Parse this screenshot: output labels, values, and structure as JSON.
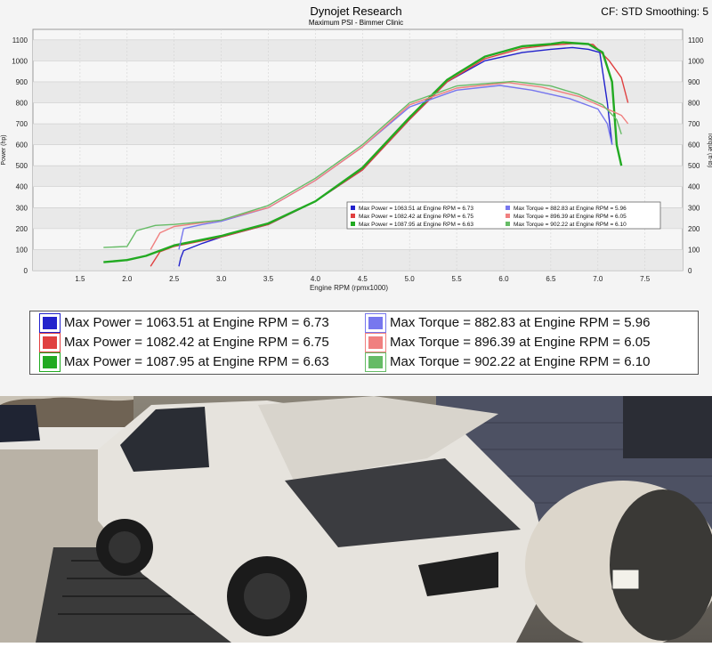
{
  "header": {
    "title": "Dynojet Research",
    "subtitle": "Maximum PSI - Bimmer Clinic",
    "right_info": "CF: STD Smoothing: 5"
  },
  "chart_data": {
    "type": "line",
    "xlabel": "Engine RPM (rpmx1000)",
    "ylabel_left": "Power (hp)",
    "ylabel_right": "Torque (ft-lb)",
    "xlim": [
      1.0,
      7.9
    ],
    "ylim": [
      0,
      1150
    ],
    "xticks": [
      "1.5",
      "2.0",
      "2.5",
      "3.0",
      "3.5",
      "4.0",
      "4.5",
      "5.0",
      "5.5",
      "6.0",
      "6.5",
      "7.0",
      "7.5"
    ],
    "yticks": [
      "0",
      "100",
      "200",
      "300",
      "400",
      "500",
      "600",
      "700",
      "800",
      "900",
      "1000",
      "1100"
    ],
    "grid": true,
    "series": [
      {
        "name": "Max Power = 1063.51 at Engine RPM = 6.73",
        "kind": "power",
        "color": "#2222cc",
        "x": [
          2.55,
          2.57,
          2.6,
          2.8,
          3.0,
          3.5,
          4.0,
          4.5,
          5.0,
          5.4,
          5.8,
          6.2,
          6.5,
          6.73,
          6.9,
          7.02,
          7.1,
          7.15
        ],
        "y": [
          20,
          60,
          95,
          130,
          160,
          220,
          330,
          480,
          720,
          900,
          1000,
          1040,
          1055,
          1063.51,
          1055,
          1040,
          800,
          600
        ]
      },
      {
        "name": "Max Power = 1082.42 at Engine RPM = 6.75",
        "kind": "power",
        "color": "#e04040",
        "x": [
          2.25,
          2.3,
          2.35,
          2.5,
          3.0,
          3.5,
          4.0,
          4.5,
          5.0,
          5.4,
          5.8,
          6.2,
          6.5,
          6.75,
          6.95,
          7.12,
          7.25,
          7.32
        ],
        "y": [
          20,
          55,
          90,
          115,
          160,
          220,
          330,
          480,
          720,
          900,
          1010,
          1060,
          1075,
          1082.42,
          1078,
          1000,
          920,
          800
        ]
      },
      {
        "name": "Max Power = 1087.95 at Engine RPM = 6.63",
        "kind": "power",
        "color": "#22aa22",
        "x": [
          1.75,
          2.0,
          2.2,
          2.5,
          3.0,
          3.5,
          4.0,
          4.5,
          5.0,
          5.4,
          5.8,
          6.2,
          6.5,
          6.63,
          6.9,
          7.05,
          7.15,
          7.2,
          7.25
        ],
        "y": [
          40,
          50,
          70,
          120,
          165,
          225,
          330,
          490,
          730,
          910,
          1020,
          1070,
          1080,
          1087.95,
          1080,
          1040,
          900,
          600,
          500
        ]
      },
      {
        "name": "Max Torque = 882.83 at Engine RPM = 5.96",
        "kind": "torque",
        "color": "#7777ee",
        "x": [
          2.55,
          2.6,
          2.8,
          3.0,
          3.5,
          4.0,
          4.5,
          5.0,
          5.5,
          5.96,
          6.3,
          6.7,
          7.0,
          7.1,
          7.15
        ],
        "y": [
          100,
          200,
          220,
          235,
          300,
          430,
          590,
          780,
          860,
          882.83,
          860,
          820,
          770,
          700,
          600
        ]
      },
      {
        "name": "Max Torque = 896.39 at Engine RPM = 6.05",
        "kind": "torque",
        "color": "#f08080",
        "x": [
          2.25,
          2.35,
          2.5,
          3.0,
          3.5,
          4.0,
          4.5,
          5.0,
          5.5,
          6.05,
          6.4,
          6.8,
          7.1,
          7.25,
          7.32
        ],
        "y": [
          100,
          180,
          210,
          240,
          300,
          430,
          590,
          790,
          870,
          896.39,
          875,
          830,
          770,
          740,
          700
        ]
      },
      {
        "name": "Max Torque = 902.22 at Engine RPM = 6.10",
        "kind": "torque",
        "color": "#66bb66",
        "x": [
          1.75,
          2.0,
          2.1,
          2.3,
          2.5,
          3.0,
          3.5,
          4.0,
          4.5,
          5.0,
          5.5,
          6.1,
          6.5,
          6.8,
          7.05,
          7.2,
          7.25
        ],
        "y": [
          110,
          115,
          190,
          215,
          220,
          240,
          310,
          440,
          600,
          800,
          880,
          902.22,
          880,
          840,
          790,
          720,
          650
        ]
      }
    ]
  },
  "big_legend": [
    {
      "label": "Max Power = 1063.51 at Engine RPM = 6.73",
      "color": "#2222cc"
    },
    {
      "label": "Max Power = 1082.42 at Engine RPM = 6.75",
      "color": "#e04040"
    },
    {
      "label": "Max Power = 1087.95 at Engine RPM = 6.63",
      "color": "#22aa22"
    },
    {
      "label": "Max Torque = 882.83 at Engine RPM = 5.96",
      "color": "#7777ee"
    },
    {
      "label": "Max Torque = 896.39 at Engine RPM = 6.05",
      "color": "#f08080"
    },
    {
      "label": "Max Torque = 902.22 at Engine RPM = 6.10",
      "color": "#66bb66"
    }
  ]
}
